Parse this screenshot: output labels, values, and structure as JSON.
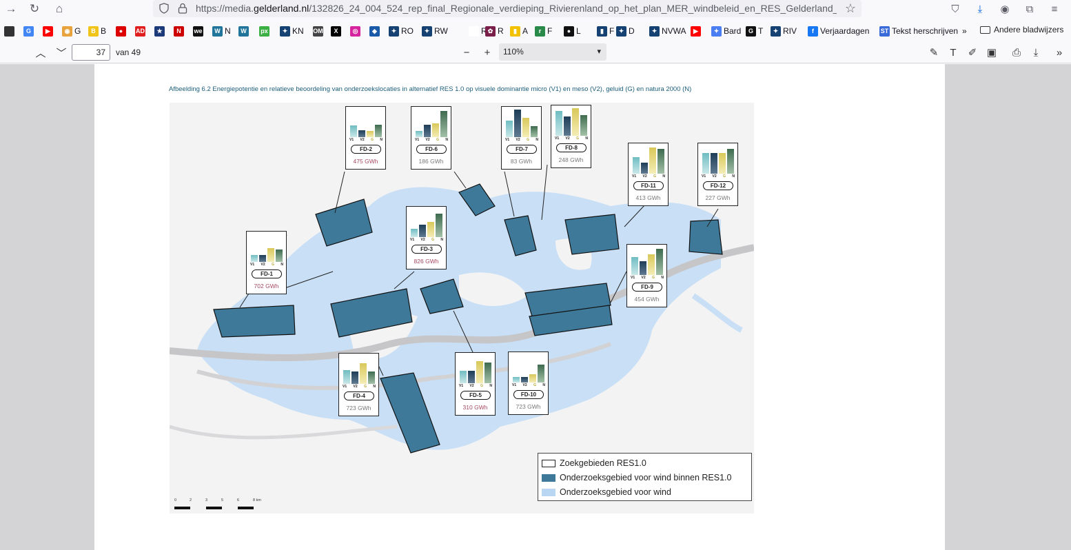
{
  "browser": {
    "url_prefix": "https://media.",
    "url_domain": "gelderland.nl",
    "url_path": "/132826_24_004_524_rep_final_Regionale_verdieping_Rivierenland_op_het_plan_MER_windbeleid_en_RES_Gelderland_Optimize"
  },
  "bookmarks": [
    {
      "label": "",
      "color": "#333"
    },
    {
      "label": "",
      "color": "#4285f4",
      "glyph": "G"
    },
    {
      "label": "",
      "color": "#ff0000",
      "glyph": "▶"
    },
    {
      "label": "G",
      "color": "#e8a33c",
      "glyph": "◉"
    },
    {
      "label": "B",
      "color": "#f0c419",
      "glyph": "B"
    },
    {
      "label": "",
      "color": "#d00",
      "glyph": "●"
    },
    {
      "label": "",
      "color": "#e01e1e",
      "glyph": "AD"
    },
    {
      "label": "",
      "color": "#1c3a7a",
      "glyph": "★"
    },
    {
      "label": "",
      "color": "#c00",
      "glyph": "N"
    },
    {
      "label": "",
      "color": "#111",
      "glyph": "we"
    },
    {
      "label": "N",
      "color": "#21759b",
      "glyph": "W"
    },
    {
      "label": "",
      "color": "#21759b",
      "glyph": "W"
    },
    {
      "label": "",
      "color": "#3cb043",
      "glyph": "px"
    },
    {
      "label": "KN",
      "color": "#154273",
      "glyph": "✦"
    },
    {
      "label": "",
      "color": "#444",
      "glyph": "OM"
    },
    {
      "label": "",
      "color": "#000",
      "glyph": "X"
    },
    {
      "label": "",
      "color": "#d6249f",
      "glyph": "◎"
    },
    {
      "label": "",
      "color": "#1a5aa8",
      "glyph": "◆"
    },
    {
      "label": "RO",
      "color": "#154273",
      "glyph": "✦"
    },
    {
      "label": "RW",
      "color": "#154273",
      "glyph": "✦"
    },
    {
      "label": "R",
      "color": "#fff",
      "glyph": ""
    },
    {
      "label": "R",
      "color": "#7a1e4a",
      "glyph": "✿"
    },
    {
      "label": "A",
      "color": "#f2c200",
      "glyph": "▮"
    },
    {
      "label": "F",
      "color": "#2a8a4a",
      "glyph": "r"
    },
    {
      "label": "L",
      "color": "#111",
      "glyph": "●"
    },
    {
      "label": "F",
      "color": "#154273",
      "glyph": "▮"
    },
    {
      "label": "D",
      "color": "#154273",
      "glyph": "✦"
    },
    {
      "label": "NVWA",
      "color": "#154273",
      "glyph": "✦"
    },
    {
      "label": "",
      "color": "#ff0000",
      "glyph": "▶"
    },
    {
      "label": "Bard",
      "color": "#4c7ef3",
      "glyph": "✦"
    },
    {
      "label": "T",
      "color": "#111",
      "glyph": "G"
    },
    {
      "label": "RIV",
      "color": "#154273",
      "glyph": "✦"
    },
    {
      "label": "Verjaardagen",
      "color": "#1877f2",
      "glyph": "f"
    },
    {
      "label": "Tekst herschrijven",
      "color": "#3a6ad8",
      "glyph": "ST"
    }
  ],
  "bookmarks_more": "»",
  "bookmarks_folder": "Andere bladwijzers",
  "pdf": {
    "page_number": "37",
    "page_of": "van 49",
    "zoom": "110%",
    "caption": "Afbeelding 6.2 Energiepotentie en relatieve beoordeling van onderzoekslocaties in alternatief RES 1.0 op visuele dominantie micro (V1) en meso (V2), geluid (G) en natura 2000 (N)"
  },
  "bar_labels": {
    "v1": "V1",
    "v2": "V2",
    "g": "G",
    "n": "N"
  },
  "fd_cards": [
    {
      "name": "FD-1",
      "gwh": "702 GWh",
      "red": true,
      "v1": 0.25,
      "v2": 0.25,
      "g": 0.5,
      "n": 0.45
    },
    {
      "name": "FD-2",
      "gwh": "475 GWh",
      "red": true,
      "v1": 0.42,
      "v2": 0.25,
      "g": 0.22,
      "n": 0.45
    },
    {
      "name": "FD-3",
      "gwh": "826 GWh",
      "red": true,
      "v1": 0.3,
      "v2": 0.45,
      "g": 0.55,
      "n": 0.85
    },
    {
      "name": "FD-4",
      "gwh": "723 GWh",
      "red": false,
      "v1": 0.5,
      "v2": 0.45,
      "g": 0.75,
      "n": 0.45
    },
    {
      "name": "FD-5",
      "gwh": "310 GWh",
      "red": true,
      "v1": 0.45,
      "v2": 0.45,
      "g": 0.8,
      "n": 0.75
    },
    {
      "name": "FD-6",
      "gwh": "186 GWh",
      "red": false,
      "v1": 0.22,
      "v2": 0.45,
      "g": 0.5,
      "n": 0.95
    },
    {
      "name": "FD-7",
      "gwh": "83 GWh",
      "red": false,
      "v1": 0.6,
      "v2": 1.0,
      "g": 0.7,
      "n": 0.4
    },
    {
      "name": "FD-8",
      "gwh": "248 GWh",
      "red": false,
      "v1": 0.9,
      "v2": 0.7,
      "g": 1.0,
      "n": 0.75
    },
    {
      "name": "FD-9",
      "gwh": "454 GWh",
      "red": false,
      "v1": 0.65,
      "v2": 0.5,
      "g": 0.75,
      "n": 0.95
    },
    {
      "name": "FD-10",
      "gwh": "723 GWh",
      "red": false,
      "v1": 0.2,
      "v2": 0.2,
      "g": 0.3,
      "n": 0.65
    },
    {
      "name": "FD-11",
      "gwh": "413 GWh",
      "red": false,
      "v1": 0.6,
      "v2": 0.4,
      "g": 0.95,
      "n": 0.9
    },
    {
      "name": "FD-12",
      "gwh": "227 GWh",
      "red": false,
      "v1": 0.75,
      "v2": 0.75,
      "g": 0.75,
      "n": 0.9
    }
  ],
  "legend": [
    {
      "label": "Zoekgebieden RES1.0",
      "color": "#ffffff"
    },
    {
      "label": "Onderzoeksgebied voor wind binnen RES1.0",
      "color": "#3f7999"
    },
    {
      "label": "Onderzoeksgebied voor wind",
      "color": "#b9d6f2"
    }
  ],
  "scale": {
    "ticks": [
      "0",
      "2",
      "3",
      "5",
      "6",
      "8 km"
    ]
  }
}
